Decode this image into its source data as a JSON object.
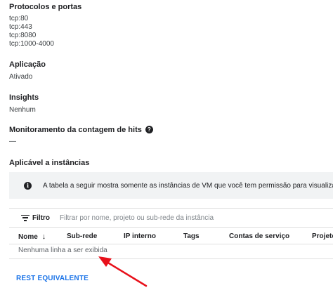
{
  "sections": {
    "protocols": {
      "title": "Protocolos e portas",
      "values": [
        "tcp:80",
        "tcp:443",
        "tcp:8080",
        "tcp:1000-4000"
      ]
    },
    "application": {
      "title": "Aplicação",
      "value": "Ativado"
    },
    "insights": {
      "title": "Insights",
      "value": "Nenhum"
    },
    "hit_count": {
      "title": "Monitoramento da contagem de hits",
      "value": "—",
      "help_icon": "?"
    },
    "applies_to": {
      "title": "Aplicável a instâncias"
    }
  },
  "info_banner": {
    "icon": "info-icon",
    "text": "A tabela a seguir mostra somente as instâncias de VM que você tem permissão para visualizar"
  },
  "filter": {
    "label": "Filtro",
    "placeholder": "Filtrar por nome, projeto ou sub-rede da instância"
  },
  "table": {
    "columns": [
      "Nome",
      "Sub-rede",
      "IP interno",
      "Tags",
      "Contas de serviço",
      "Projeto"
    ],
    "sort_column": "Nome",
    "sort_direction": "descending",
    "empty_message": "Nenhuma linha a ser exibida"
  },
  "rest_link": "REST EQUIVALENTE",
  "colors": {
    "annotation_arrow": "#e8101a",
    "link": "#1a73e8",
    "banner_background": "#f1f3f4"
  }
}
